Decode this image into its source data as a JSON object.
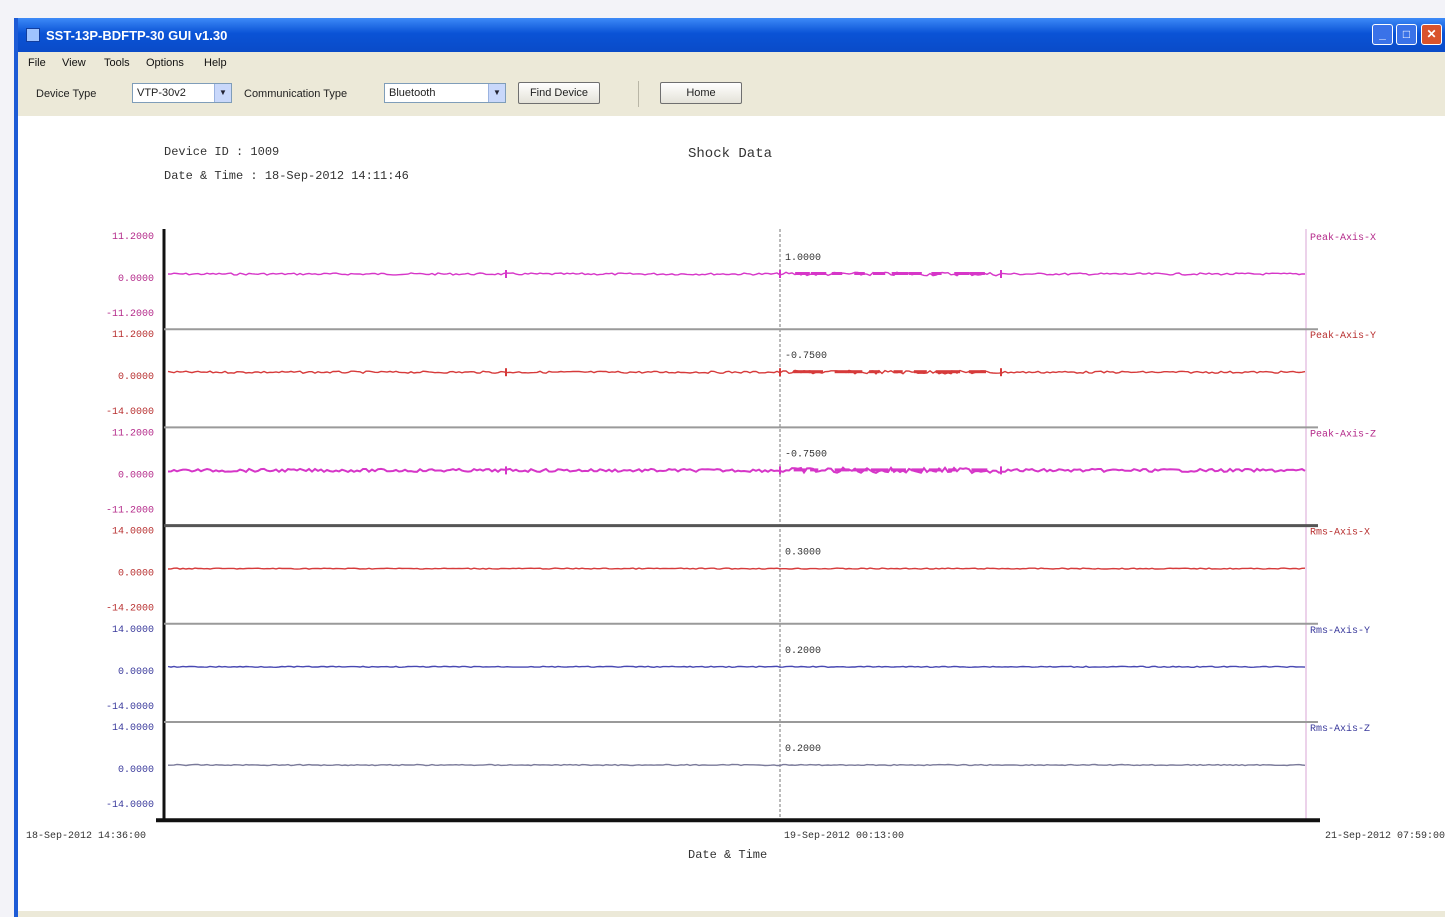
{
  "window": {
    "title": "SST-13P-BDFTP-30 GUI v1.30",
    "buttons": {
      "minimize": "_",
      "maximize": "□",
      "close": "✕"
    }
  },
  "menu": [
    "File",
    "View",
    "Tools",
    "Options",
    "Help"
  ],
  "toolbar": {
    "device_type_label": "Device Type",
    "device_type_value": "VTP-30v2",
    "communication_type_label": "Communication Type",
    "communication_type_value": "Bluetooth",
    "find_device_label": "Find Device",
    "home_label": "Home"
  },
  "header": {
    "device_id": "Device ID : 1009",
    "date_time": "Date & Time : 18-Sep-2012 14:11:46",
    "title": "Shock Data"
  },
  "colors": {
    "peak_trace": "#d636c8",
    "peak_axis": "#b42a8a",
    "red_trace": "#d63a3a",
    "red_axis": "#b83030",
    "blue_trace": "#4747b2",
    "blue_axis": "#3a3a9c",
    "gray_trace": "#7a7a9a"
  },
  "chart_data": {
    "type": "line",
    "title": "Shock Data",
    "xlabel": "Date & Time",
    "x_ticks": [
      "18-Sep-2012 14:36:00",
      "19-Sep-2012 00:13:00",
      "21-Sep-2012 07:59:00"
    ],
    "marker_x_label": "19-Sep-2012 00:13:00",
    "channels": [
      {
        "name": "Peak-Axis-X",
        "ticks": [
          "11.2000",
          "0.0000",
          "-11.2000"
        ],
        "ylim": [
          -11.2,
          11.2
        ],
        "cursor_value": "1.0000",
        "color_key": "peak_trace",
        "axis_key": "peak_axis",
        "activity": "high"
      },
      {
        "name": "Peak-Axis-Y",
        "ticks": [
          "11.2000",
          "0.0000",
          "-14.0000"
        ],
        "ylim": [
          -14.0,
          11.2
        ],
        "cursor_value": "-0.7500",
        "color_key": "red_trace",
        "axis_key": "red_axis",
        "activity": "high"
      },
      {
        "name": "Peak-Axis-Z",
        "ticks": [
          "11.2000",
          "0.0000",
          "-11.2000"
        ],
        "ylim": [
          -11.2,
          11.2
        ],
        "cursor_value": "-0.7500",
        "color_key": "peak_trace",
        "axis_key": "peak_axis",
        "activity": "very-high"
      },
      {
        "name": "Rms-Axis-X",
        "ticks": [
          "14.0000",
          "0.0000",
          "-14.2000"
        ],
        "ylim": [
          -14.2,
          14.0
        ],
        "cursor_value": "0.3000",
        "color_key": "red_trace",
        "axis_key": "red_axis",
        "activity": "low"
      },
      {
        "name": "Rms-Axis-Y",
        "ticks": [
          "14.0000",
          "0.0000",
          "-14.0000"
        ],
        "ylim": [
          -14.0,
          14.0
        ],
        "cursor_value": "0.2000",
        "color_key": "blue_trace",
        "axis_key": "blue_axis",
        "activity": "low"
      },
      {
        "name": "Rms-Axis-Z",
        "ticks": [
          "14.0000",
          "0.0000",
          "-14.0000"
        ],
        "ylim": [
          -14.0,
          14.0
        ],
        "cursor_value": "0.2000",
        "color_key": "gray_trace",
        "axis_key": "blue_axis",
        "activity": "low"
      }
    ]
  }
}
